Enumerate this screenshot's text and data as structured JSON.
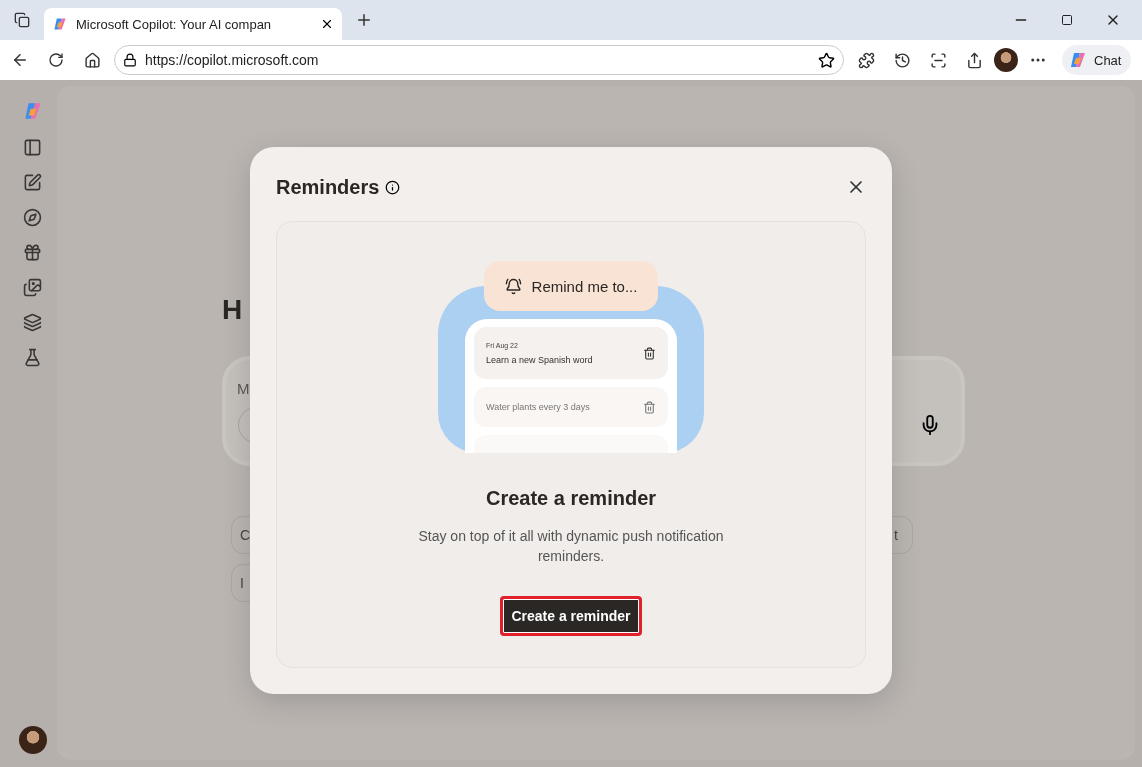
{
  "browser": {
    "tab": {
      "title": "Microsoft Copilot: Your AI compan"
    },
    "address": {
      "url": "https://copilot.microsoft.com"
    },
    "chat_button": {
      "label": "Chat"
    }
  },
  "background": {
    "heading": "H",
    "composer_placeholder": "M",
    "chip_rows": [
      [
        {
          "label": "C"
        },
        {
          "label": "t"
        }
      ],
      [
        {
          "label": "I"
        }
      ]
    ]
  },
  "modal": {
    "title": "Reminders",
    "illustration": {
      "prompt": "Remind me to...",
      "reminders": [
        {
          "date": "Fri Aug 22",
          "text": "Learn a new Spanish word"
        },
        {
          "text": "Water plants every 3 days"
        }
      ]
    },
    "heading": "Create a reminder",
    "description": "Stay on top of it all with dynamic push notification reminders.",
    "button": {
      "label": "Create a reminder",
      "highlighted": true
    }
  }
}
